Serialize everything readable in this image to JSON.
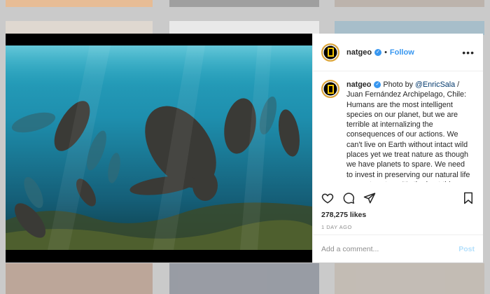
{
  "post": {
    "username": "natgeo",
    "verified_mark": "✓",
    "separator": "•",
    "follow_label": "Follow",
    "more_label": "•••",
    "caption_prefix": "Photo by ",
    "caption_mention": "@EnricSala",
    "caption_body": " / Juan Fernández Archipelago, Chile: Humans are the most intelligent species on our planet, but we are terrible at internalizing the consequences of our actions. We can't live on Earth without intact wild places yet we treat nature as though we have planets to spare. We need to invest in preserving our natural life support system. It's the best thing",
    "likes": "278,275 likes",
    "timestamp": "1 DAY AGO",
    "comment_placeholder": "Add a comment...",
    "post_label": "Post",
    "photo_subject": "sea lions swimming underwater"
  },
  "icons": {
    "like": "heart-icon",
    "comment": "comment-icon",
    "share": "share-icon",
    "save": "bookmark-icon"
  },
  "colors": {
    "link_blue": "#3897f0",
    "avatar_ring": "#e0a83a",
    "natgeo_yellow": "#f6c500",
    "post_disabled": "#b2dffc"
  }
}
